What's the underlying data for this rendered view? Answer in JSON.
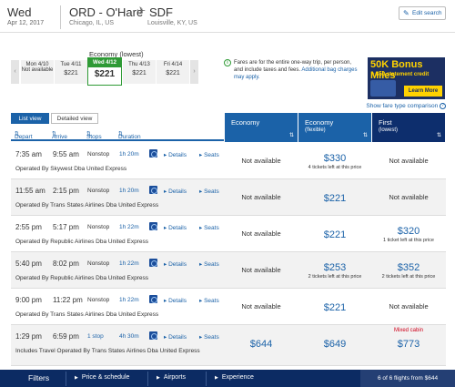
{
  "header": {
    "day": "Wed",
    "date": "Apr 12, 2017",
    "route": "ORD - O'Hare",
    "origin_city": "Chicago, IL, US",
    "dest_code": "SDF",
    "dest_city": "Louisville, KY, US",
    "edit_search": "Edit search"
  },
  "date_strip": {
    "title": "Economy (lowest)",
    "days": [
      {
        "label": "Mon 4/10",
        "price": "Not available"
      },
      {
        "label": "Tue 4/11",
        "price": "$221"
      },
      {
        "label": "Wed 4/12",
        "price": "$221"
      },
      {
        "label": "Thu 4/13",
        "price": "$221"
      },
      {
        "label": "Fri 4/14",
        "price": "$221"
      }
    ]
  },
  "note": {
    "text": "Fares are for the entire one-way trip, per person, and include taxes and fees.",
    "link": "Additional bag charges may apply."
  },
  "ad": {
    "headline": "50K Bonus Miles",
    "sub": "+ $50 statement credit",
    "cta": "Learn More"
  },
  "compare_link": "Show fare type comparison",
  "views": {
    "list": "List view",
    "detailed": "Detailed view"
  },
  "sort": {
    "depart": "Depart",
    "arrive": "Arrive",
    "stops": "Stops",
    "duration": "Duration"
  },
  "columns": [
    {
      "name": "Economy",
      "sub": ""
    },
    {
      "name": "Economy",
      "sub": "(flexible)"
    },
    {
      "name": "First",
      "sub": "(lowest)"
    }
  ],
  "link_labels": {
    "details": "Details",
    "seats": "Seats"
  },
  "flights": [
    {
      "depart": "7:35 am",
      "arrive": "9:55 am",
      "stops": "Nonstop",
      "duration": "1h 20m",
      "operator": "Operated By Skywest Dba United Express",
      "fares": [
        {
          "price": "Not available",
          "note": ""
        },
        {
          "price": "$330",
          "note": "4 tickets left at this price"
        },
        {
          "price": "Not available",
          "note": ""
        }
      ]
    },
    {
      "depart": "11:55 am",
      "arrive": "2:15 pm",
      "stops": "Nonstop",
      "duration": "1h 20m",
      "operator": "Operated By Trans States Airlines Dba United Express",
      "fares": [
        {
          "price": "Not available",
          "note": ""
        },
        {
          "price": "$221",
          "note": ""
        },
        {
          "price": "Not available",
          "note": ""
        }
      ]
    },
    {
      "depart": "2:55 pm",
      "arrive": "5:17 pm",
      "stops": "Nonstop",
      "duration": "1h 22m",
      "operator": "Operated By Republic Airlines Dba United Express",
      "fares": [
        {
          "price": "Not available",
          "note": ""
        },
        {
          "price": "$221",
          "note": ""
        },
        {
          "price": "$320",
          "note": "1 ticket left at this price"
        }
      ]
    },
    {
      "depart": "5:40 pm",
      "arrive": "8:02 pm",
      "stops": "Nonstop",
      "duration": "1h 22m",
      "operator": "Operated By Republic Airlines Dba United Express",
      "fares": [
        {
          "price": "Not available",
          "note": ""
        },
        {
          "price": "$253",
          "note": "2 tickets left at this price"
        },
        {
          "price": "$352",
          "note": "2 tickets left at this price"
        }
      ]
    },
    {
      "depart": "9:00 pm",
      "arrive": "11:22 pm",
      "stops": "Nonstop",
      "duration": "1h 22m",
      "operator": "Operated By Trans States Airlines Dba United Express",
      "fares": [
        {
          "price": "Not available",
          "note": ""
        },
        {
          "price": "$221",
          "note": ""
        },
        {
          "price": "Not available",
          "note": ""
        }
      ]
    },
    {
      "depart": "1:29 pm",
      "arrive": "6:59 pm",
      "stops": "1 stop",
      "duration": "4h 30m",
      "operator": "Includes Travel Operated By Trans States Airlines Dba United Express",
      "mixed": "Mixed cabin",
      "fares": [
        {
          "price": "$644",
          "note": ""
        },
        {
          "price": "$649",
          "note": ""
        },
        {
          "price": "$773",
          "note": ""
        }
      ]
    }
  ],
  "footer": {
    "filters": "Filters",
    "items": [
      "Price & schedule",
      "Airports",
      "Experience"
    ],
    "count": "6 of 6 flights from $644"
  },
  "colors": {
    "brand_blue": "#1b62a8",
    "navy": "#0c2b63",
    "selected_green": "#2e9a35",
    "mixed_red": "#d0021b"
  }
}
